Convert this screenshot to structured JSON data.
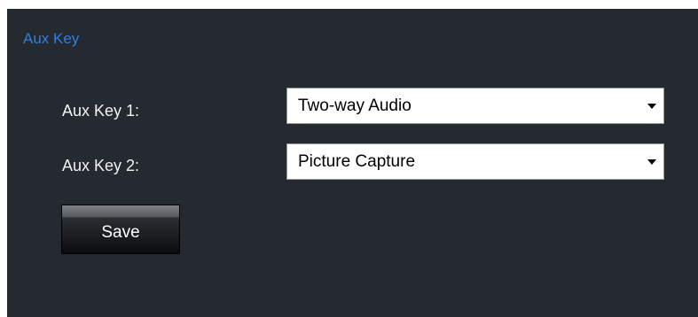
{
  "panel": {
    "title": "Aux Key",
    "title_color": "#2f7fe0",
    "background": "#252a31"
  },
  "form": {
    "rows": [
      {
        "label": "Aux Key 1:",
        "selected": "Two-way Audio"
      },
      {
        "label": "Aux Key 2:",
        "selected": "Picture Capture"
      }
    ],
    "save_label": "Save"
  },
  "icons": {
    "dropdown": "chevron-down-icon"
  }
}
